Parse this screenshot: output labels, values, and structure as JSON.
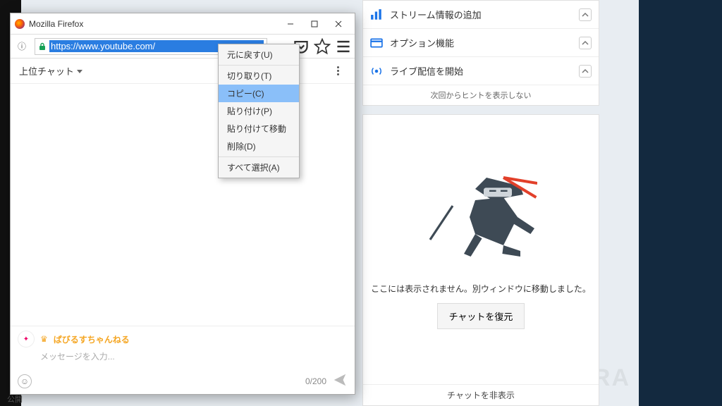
{
  "firefox": {
    "title": "Mozilla Firefox",
    "url": "https://www.youtube.com/",
    "ctx": {
      "undo": "元に戻す(U)",
      "cut": "切り取り(T)",
      "copy": "コピー(C)",
      "paste": "貼り付け(P)",
      "pastego": "貼り付けて移動",
      "delete": "削除(D)",
      "selectall": "すべて選択(A)"
    }
  },
  "chat": {
    "top_label": "上位チャット",
    "channel_name": "ぱびるすちゃんねる",
    "placeholder": "メッセージを入力...",
    "counter": "0/200"
  },
  "settings": {
    "stream_info": "ストリーム情報の追加",
    "option": "オプション機能",
    "live_start": "ライブ配信を開始",
    "hint_off": "次回からヒントを表示しない"
  },
  "ninja": {
    "msg": "ここには表示されません。別ウィンドウに移動しました。",
    "restore": "チャットを復元",
    "hide": "チャットを非表示"
  },
  "bg": {
    "publish": "公開"
  },
  "watermark": "ARUTORA"
}
